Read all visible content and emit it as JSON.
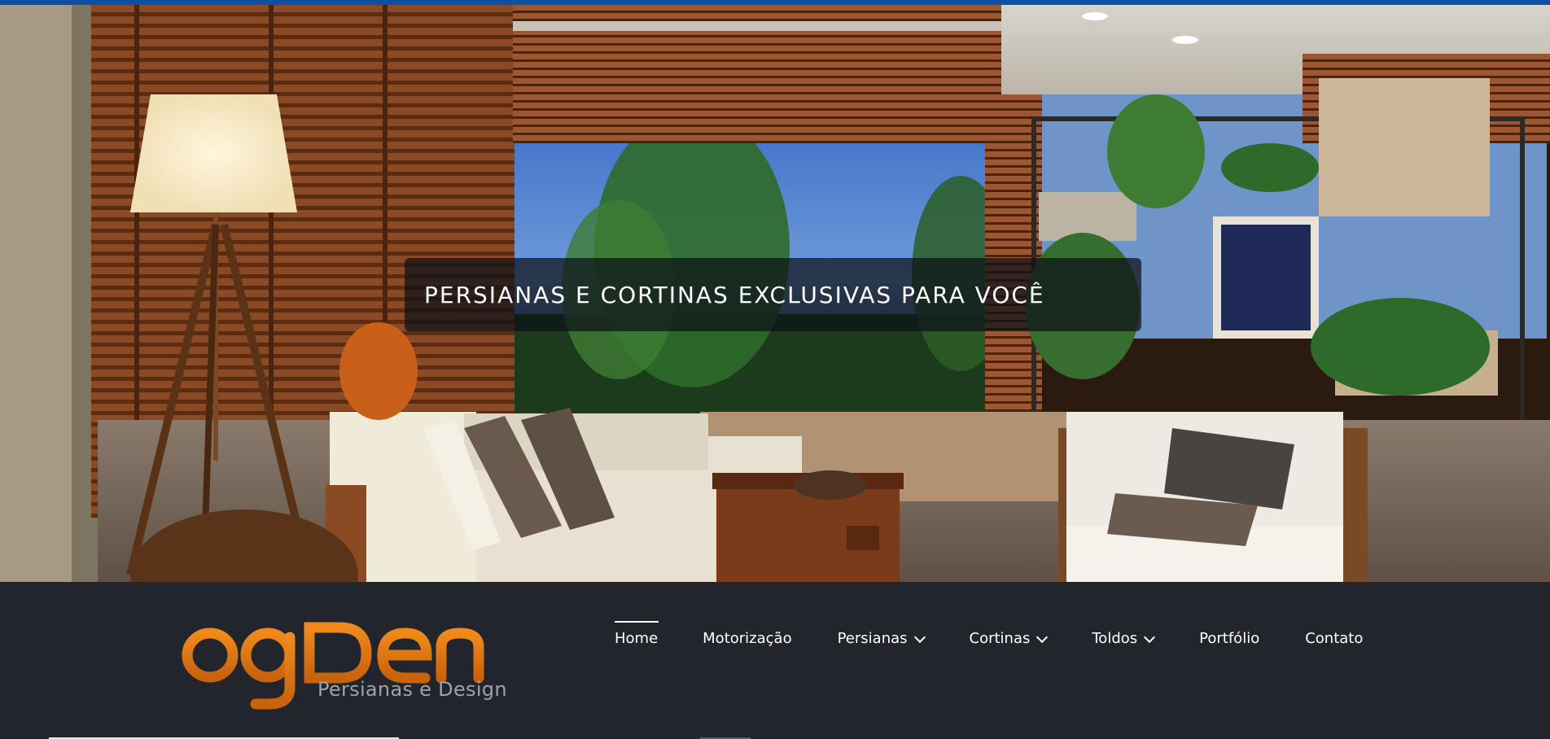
{
  "hero": {
    "caption": "PERSIANAS E CORTINAS EXCLUSIVAS PARA VOCÊ"
  },
  "brand": {
    "name": "ogDen",
    "tagline": "Persianas e Design",
    "color": "#e07a12"
  },
  "nav": {
    "items": [
      {
        "label": "Home",
        "dropdown": false,
        "active": true
      },
      {
        "label": "Motorização",
        "dropdown": false
      },
      {
        "label": "Persianas",
        "dropdown": true
      },
      {
        "label": "Cortinas",
        "dropdown": true
      },
      {
        "label": "Toldos",
        "dropdown": true
      },
      {
        "label": "Portfólio",
        "dropdown": false
      },
      {
        "label": "Contato",
        "dropdown": false
      }
    ]
  },
  "colors": {
    "top_bar": "#0d4fa3",
    "header_bg": "#22252c",
    "nav_text": "#ffffff"
  },
  "icons": {
    "dropdown": "chevron-down-icon"
  }
}
